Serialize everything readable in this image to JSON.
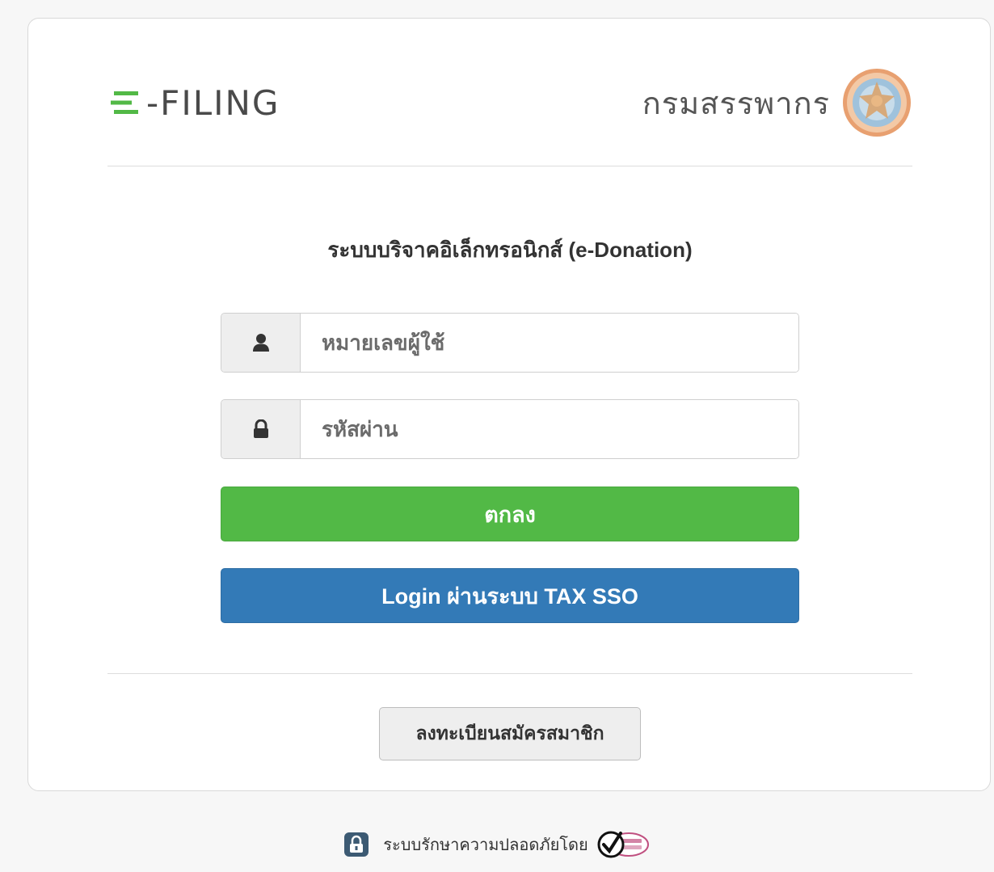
{
  "header": {
    "efiling_logo_text": "-FILING",
    "rd_logo_text": "กรมสรรพากร",
    "colors": {
      "efiling_green": "#52b946",
      "logo_gray": "#4a4a4a"
    }
  },
  "main": {
    "system_title": "ระบบบริจาคอิเล็กทรอนิกส์ (e-Donation)",
    "username": {
      "icon": "user-icon",
      "placeholder": "หมายเลขผู้ใช้",
      "value": ""
    },
    "password": {
      "icon": "lock-icon",
      "placeholder": "รหัสผ่าน",
      "value": ""
    },
    "submit_label": "ตกลง",
    "sso_label": "Login ผ่านระบบ TAX SSO",
    "register_label": "ลงทะเบียนสมัครสมาชิก",
    "colors": {
      "submit": "#52b946",
      "sso": "#337ab7",
      "register": "#eeeeee"
    }
  },
  "footer": {
    "security_text": "ระบบรักษาความปลอดภัยโดย",
    "icons": [
      "padlock-badge-icon",
      "verified-secured-badge-icon"
    ]
  }
}
